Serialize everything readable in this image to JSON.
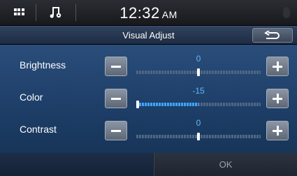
{
  "status_bar": {
    "icons": [
      "grid-icon",
      "music-settings-icon",
      "microphone-icon"
    ],
    "time": "12:32",
    "ampm": "AM"
  },
  "title_bar": {
    "title": "Visual Adjust",
    "back_icon": "back-arrow-icon"
  },
  "settings": [
    {
      "id": "brightness",
      "label": "Brightness",
      "value": "0",
      "level": 0,
      "min": -15,
      "max": 15
    },
    {
      "id": "color",
      "label": "Color",
      "value": "-15",
      "level": -15,
      "min": -15,
      "max": 15
    },
    {
      "id": "contrast",
      "label": "Contrast",
      "value": "0",
      "level": 0,
      "min": -15,
      "max": 15
    }
  ],
  "controls": {
    "minus_icon": "minus-icon",
    "plus_icon": "plus-icon"
  },
  "footer": {
    "ok_label": "OK"
  },
  "colors": {
    "panel": "#1e3f69",
    "value_text": "#5fb8ff",
    "track_fill": "#3fa5ff"
  }
}
